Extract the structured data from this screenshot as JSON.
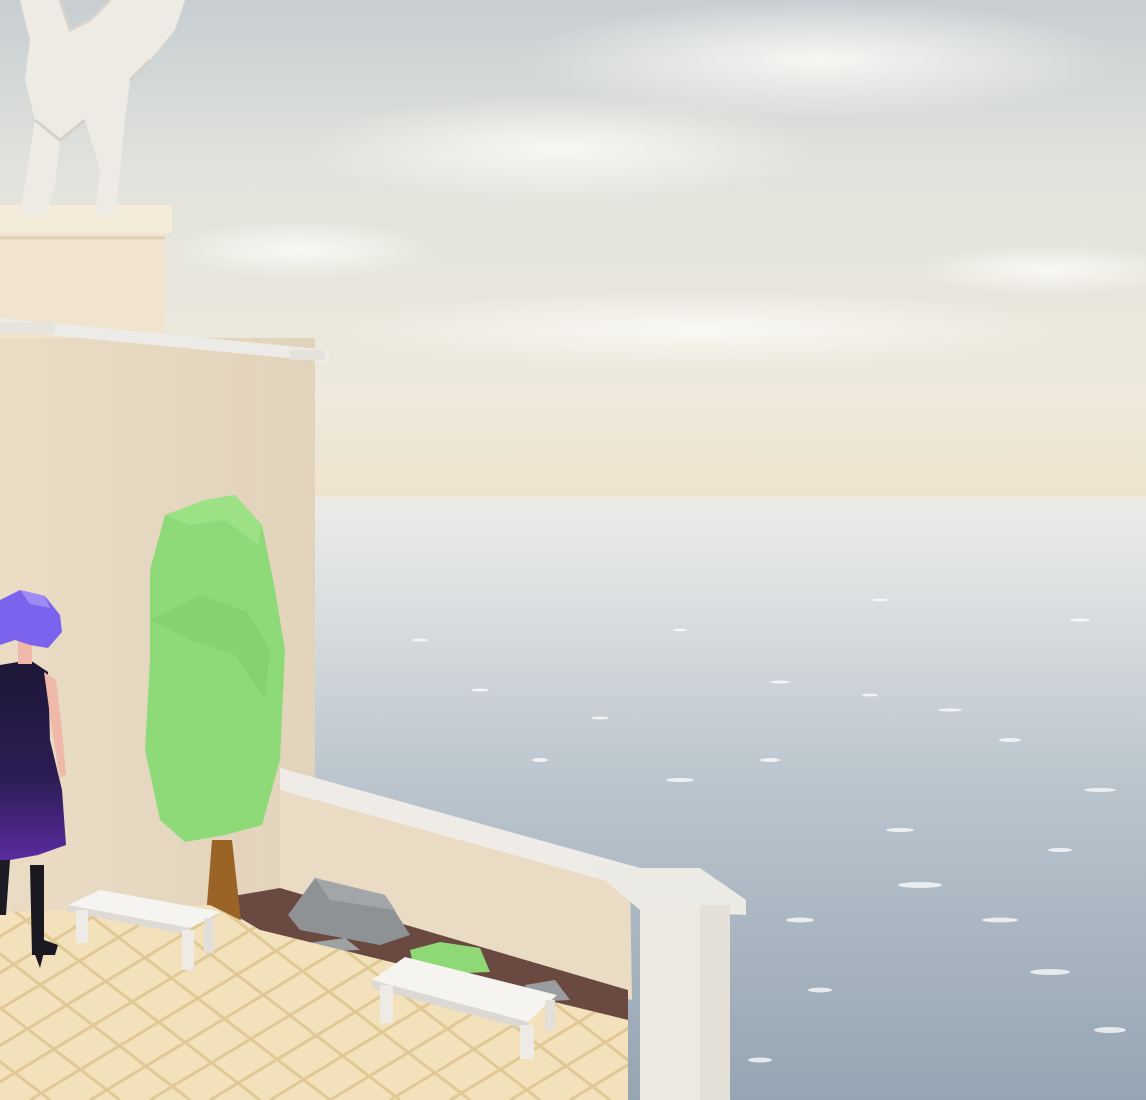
{
  "scene": {
    "description_free": true,
    "palette": {
      "sky_top": "#c9cfd3",
      "sky_mid": "#e6e6de",
      "horizon": "#f0e8d6",
      "sea_top": "#e6e8e6",
      "sea_bottom": "#9eadba",
      "wall": "#e9dcc6",
      "wall_shadow": "#d6c6ae",
      "marble": "#ece9e4",
      "tile": "#f2e2bd",
      "tile_line": "#e2cc9c",
      "foliage": "#8fda78",
      "foliage_dark": "#79c865",
      "trunk": "#9a6426",
      "rock": "#8f9295",
      "dress": "#1e1838",
      "dress_accent": "#5a2ba0",
      "hair": "#7a62ec",
      "skin": "#f0b8a8"
    }
  }
}
